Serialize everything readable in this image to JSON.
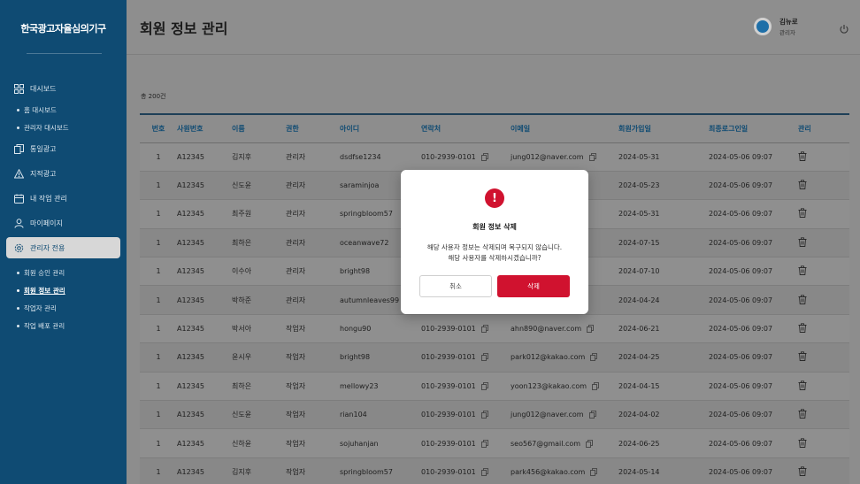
{
  "sidebar": {
    "logo": "한국광고자율심의기구",
    "items": [
      {
        "label": "대시보드",
        "icon": "grid-icon"
      },
      {
        "label": "통일광고",
        "icon": "document-copy-icon"
      },
      {
        "label": "지적광고",
        "icon": "warning-icon"
      },
      {
        "label": "내 작업 관리",
        "icon": "calendar-icon"
      },
      {
        "label": "마이페이지",
        "icon": "user-icon"
      },
      {
        "label": "관리자 전용",
        "icon": "gear-icon"
      }
    ],
    "dashboard_sub": [
      "홈 대시보드",
      "관리자 대시보드"
    ],
    "admin_sub": [
      "회원 승인 관리",
      "회원 정보 관리",
      "작업자 관리",
      "작업 배포 관리"
    ]
  },
  "header": {
    "title": "회원 정보 관리",
    "user_name": "김뉴로",
    "user_role": "관리자"
  },
  "list": {
    "count": "총 200건",
    "columns": [
      "번호",
      "사원번호",
      "이름",
      "권한",
      "아이디",
      "연락처",
      "이메일",
      "회원가입일",
      "최종로그인일",
      "관리"
    ],
    "rows": [
      [
        "1",
        "A12345",
        "김지후",
        "관리자",
        "dsdfse1234",
        "010-2939-0101",
        "jung012@naver.com",
        "2024-05-31",
        "2024-05-06 09:07"
      ],
      [
        "1",
        "A12345",
        "신도윤",
        "관리자",
        "saraminjoa",
        "",
        "",
        "2024-05-23",
        "2024-05-06 09:07"
      ],
      [
        "1",
        "A12345",
        "최주원",
        "관리자",
        "springbloom57",
        "",
        "",
        "2024-05-31",
        "2024-05-06 09:07"
      ],
      [
        "1",
        "A12345",
        "최하은",
        "관리자",
        "oceanwave72",
        "",
        "",
        "2024-07-15",
        "2024-05-06 09:07"
      ],
      [
        "1",
        "A12345",
        "이수아",
        "관리자",
        "bright98",
        "",
        "",
        "2024-07-10",
        "2024-05-06 09:07"
      ],
      [
        "1",
        "A12345",
        "박하준",
        "관리자",
        "autumnleaves99",
        "",
        "",
        "2024-04-24",
        "2024-05-06 09:07"
      ],
      [
        "1",
        "A12345",
        "박서아",
        "작업자",
        "hongu90",
        "010-2939-0101",
        "ahn890@naver.com",
        "2024-06-21",
        "2024-05-06 09:07"
      ],
      [
        "1",
        "A12345",
        "윤시우",
        "작업자",
        "bright98",
        "010-2939-0101",
        "park012@kakao.com",
        "2024-04-25",
        "2024-05-06 09:07"
      ],
      [
        "1",
        "A12345",
        "최하은",
        "작업자",
        "mellowy23",
        "010-2939-0101",
        "yoon123@kakao.com",
        "2024-04-15",
        "2024-05-06 09:07"
      ],
      [
        "1",
        "A12345",
        "신도윤",
        "작업자",
        "rian104",
        "010-2939-0101",
        "jung012@naver.com",
        "2024-04-02",
        "2024-05-06 09:07"
      ],
      [
        "1",
        "A12345",
        "신하윤",
        "작업자",
        "sojuhanjan",
        "010-2939-0101",
        "seo567@gmail.com",
        "2024-06-25",
        "2024-05-06 09:07"
      ],
      [
        "1",
        "A12345",
        "김지후",
        "작업자",
        "springbloom57",
        "010-2939-0101",
        "park456@kakao.com",
        "2024-05-14",
        "2024-05-06 09:07"
      ]
    ]
  },
  "modal": {
    "title": "회원 정보 삭제",
    "line1": "해당 사용자 정보는 삭제되며 복구되지 않습니다.",
    "line2": "해당 사용자를 삭제하시겠습니까?",
    "cancel": "취소",
    "confirm": "삭제",
    "accent": "#d0122f"
  }
}
